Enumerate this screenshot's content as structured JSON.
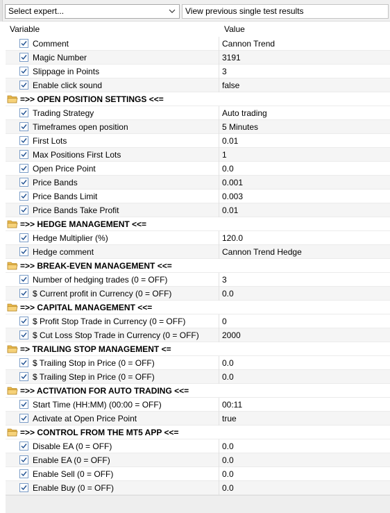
{
  "toolbar": {
    "expert_select_value": "Select expert...",
    "results_button_label": "View previous single test results"
  },
  "columns": {
    "variable": "Variable",
    "value": "Value"
  },
  "rows": [
    {
      "type": "param",
      "name": "Comment",
      "value": "Cannon Trend"
    },
    {
      "type": "param",
      "name": "Magic Number",
      "value": "3191"
    },
    {
      "type": "param",
      "name": "Slippage in Points",
      "value": "3"
    },
    {
      "type": "param",
      "name": "Enable click sound",
      "value": "false"
    },
    {
      "type": "group",
      "name": "=>> OPEN POSITION SETTINGS <<="
    },
    {
      "type": "param",
      "name": "Trading Strategy",
      "value": "Auto trading"
    },
    {
      "type": "param",
      "name": "Timeframes open position",
      "value": "5 Minutes"
    },
    {
      "type": "param",
      "name": "First Lots",
      "value": "0.01"
    },
    {
      "type": "param",
      "name": "Max Positions First Lots",
      "value": "1"
    },
    {
      "type": "param",
      "name": "Open Price Point",
      "value": "0.0"
    },
    {
      "type": "param",
      "name": "Price Bands",
      "value": "0.001"
    },
    {
      "type": "param",
      "name": "Price Bands Limit",
      "value": "0.003"
    },
    {
      "type": "param",
      "name": "Price Bands Take Profit",
      "value": "0.01"
    },
    {
      "type": "group",
      "name": "=>> HEDGE MANAGEMENT <<="
    },
    {
      "type": "param",
      "name": "Hedge Multiplier (%)",
      "value": "120.0"
    },
    {
      "type": "param",
      "name": "Hedge comment",
      "value": "Cannon Trend Hedge"
    },
    {
      "type": "group",
      "name": "=>> BREAK-EVEN MANAGEMENT <<="
    },
    {
      "type": "param",
      "name": "Number of hedging trades (0 = OFF)",
      "value": "3"
    },
    {
      "type": "param",
      "name": "$ Current profit in Currency (0 = OFF)",
      "value": "0.0"
    },
    {
      "type": "group",
      "name": "=>> CAPITAL MANAGEMENT <<="
    },
    {
      "type": "param",
      "name": "$ Profit Stop Trade in Currency (0 = OFF)",
      "value": "0"
    },
    {
      "type": "param",
      "name": "$ Cut Loss Stop Trade in Currency (0 = OFF)",
      "value": "2000"
    },
    {
      "type": "group",
      "name": "=> TRAILING STOP MANAGEMENT <="
    },
    {
      "type": "param",
      "name": "$ Trailing Stop in Price (0 = OFF)",
      "value": "0.0"
    },
    {
      "type": "param",
      "name": "$ Trailing Step in Price (0 = OFF)",
      "value": "0.0"
    },
    {
      "type": "group",
      "name": "=>> ACTIVATION FOR AUTO TRADING <<="
    },
    {
      "type": "param",
      "name": "Start Time (HH:MM) (00:00 = OFF)",
      "value": "00:11"
    },
    {
      "type": "param",
      "name": "Activate at Open Price Point",
      "value": "true"
    },
    {
      "type": "group",
      "name": "=>> CONTROL FROM THE MT5 APP <<="
    },
    {
      "type": "param",
      "name": "Disable EA (0 = OFF)",
      "value": "0.0"
    },
    {
      "type": "param",
      "name": "Enable EA (0 = OFF)",
      "value": "0.0"
    },
    {
      "type": "param",
      "name": "Enable Sell (0 = OFF)",
      "value": "0.0"
    },
    {
      "type": "param",
      "name": "Enable Buy (0 = OFF)",
      "value": "0.0"
    }
  ],
  "icons": {
    "checkbox": "checkbox-checked-icon",
    "group": "folder-open-icon",
    "dropdown": "chevron-down-icon"
  },
  "colors": {
    "check": "#1e4f91",
    "folder": "#e8b84a",
    "alt_row": "#f5f5f5"
  }
}
